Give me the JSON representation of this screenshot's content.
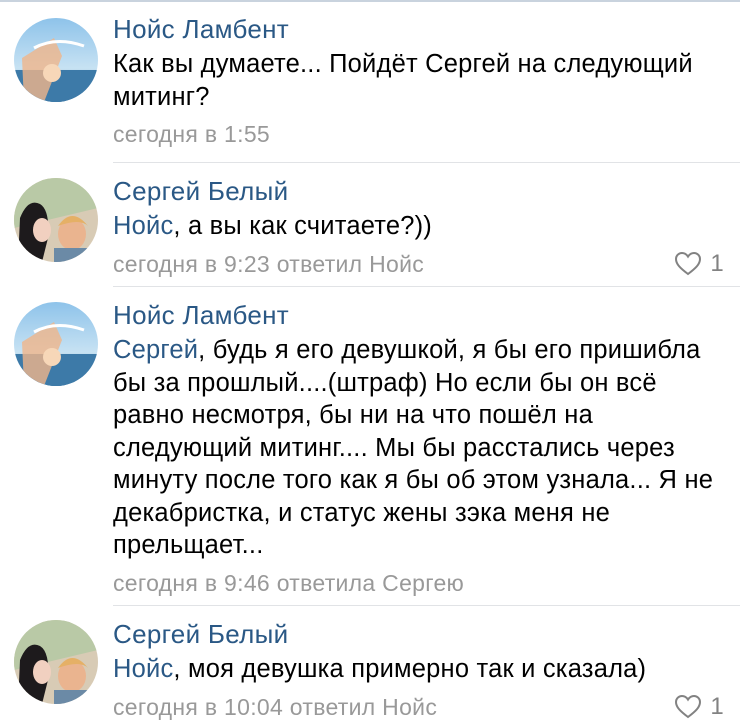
{
  "comments": [
    {
      "author": "Нойс Ламбент",
      "mention": "",
      "text": "Как вы думаете... Пойдёт Сергей на следующий митинг?",
      "meta": "сегодня в 1:55",
      "likes": ""
    },
    {
      "author": "Сергей Белый",
      "mention": "Нойс",
      "text": ", а вы как считаете?))",
      "meta": "сегодня в 9:23 ответил Нойс",
      "likes": "1"
    },
    {
      "author": "Нойс Ламбент",
      "mention": "Сергей",
      "text": ", будь я его девушкой, я бы его пришибла бы за прошлый....(штраф) Но если бы он всё равно несмотря, бы ни на что пошёл на следующий митинг.... Мы бы расстались через минуту после того как я бы об этом узнала... Я не декабристка, и статус жены зэка меня не прельщает...",
      "meta": "сегодня в 9:46 ответила Сергею",
      "likes": ""
    },
    {
      "author": "Сергей Белый",
      "mention": "Нойс",
      "text": ", моя девушка примерно так и сказала)",
      "meta": "сегодня в 10:04 ответил Нойс",
      "likes": "1"
    }
  ],
  "colors": {
    "link": "#2a5885",
    "meta": "#999999",
    "separator": "#e1e3e6"
  },
  "icons": {
    "like": "heart-outline-icon"
  }
}
